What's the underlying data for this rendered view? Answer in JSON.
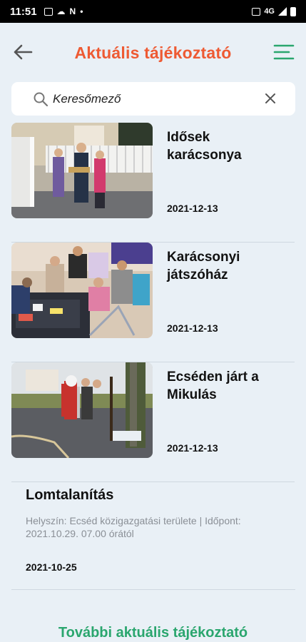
{
  "status_bar": {
    "time": "11:51",
    "left_icons": [
      "image-icon",
      "cloud-icon",
      "n-icon",
      "dot-icon"
    ],
    "right_icons": [
      "sim-icon",
      "4g-signal-icon",
      "battery-icon"
    ],
    "network": "4G"
  },
  "header": {
    "title": "Aktuális tájékoztató",
    "back_icon": "arrow-left-icon",
    "menu_icon": "menu-icon"
  },
  "search": {
    "placeholder": "Keresőmező",
    "value": ""
  },
  "news": [
    {
      "title": "Idősek karácsonya",
      "date": "2021-12-13",
      "image": "photo-elderly-christmas"
    },
    {
      "title": "Karácsonyi játszóház",
      "date": "2021-12-13",
      "image": "photo-christmas-playhouse"
    },
    {
      "title": "Ecséden járt a Mikulás",
      "date": "2021-12-13",
      "image": "photo-santa-visit"
    }
  ],
  "notice": {
    "title": "Lomtalanítás",
    "description": "Helyszín: Ecséd közigazgatási területe | Időpont: 2021.10.29. 07.00 órától",
    "date": "2021-10-25"
  },
  "more_link": "További aktuális tájékoztató",
  "colors": {
    "title_orange": "#ee5a33",
    "accent_green": "#2aa66e",
    "background": "#e9f0f6"
  }
}
